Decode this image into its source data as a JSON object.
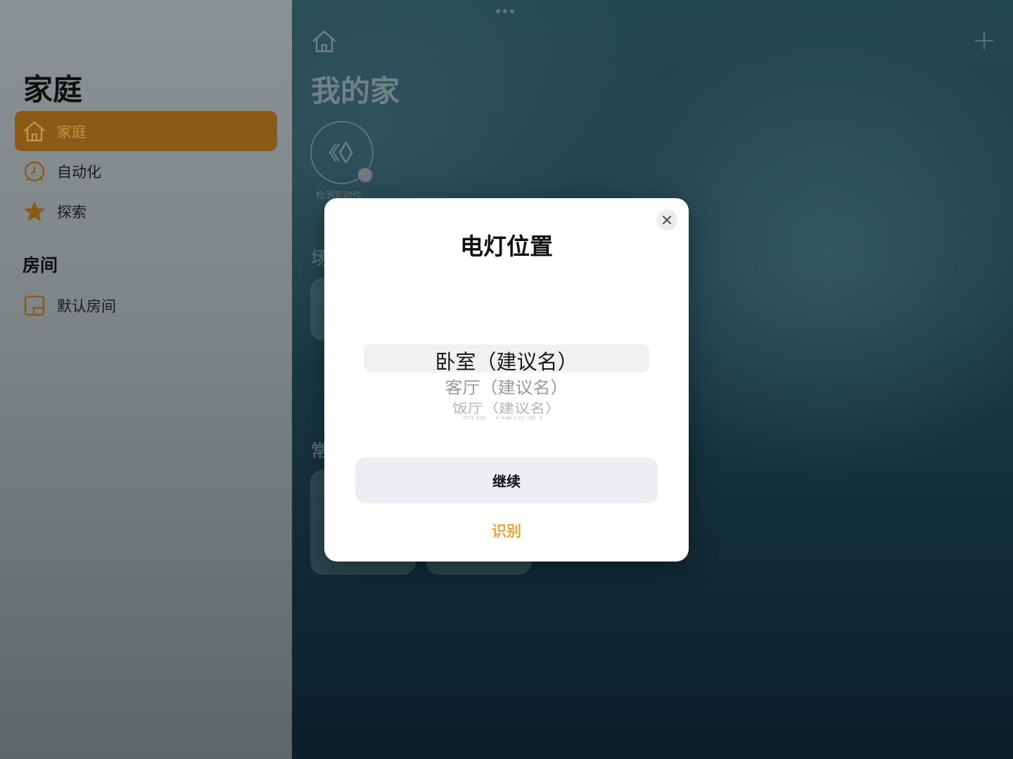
{
  "sidebar": {
    "title": "家庭",
    "items": [
      {
        "label": "家庭",
        "icon": "home-icon",
        "active": true
      },
      {
        "label": "自动化",
        "icon": "clock-icon",
        "active": false
      },
      {
        "label": "探索",
        "icon": "star-icon",
        "active": false
      }
    ],
    "rooms_section": {
      "title": "房间",
      "items": [
        {
          "label": "默认房间",
          "icon": "room-icon"
        }
      ]
    }
  },
  "main": {
    "title": "我的家",
    "status": {
      "label": "检测到动作",
      "icon": "motion-sensor-icon"
    },
    "section_peeks": [
      "场",
      "常"
    ]
  },
  "modal": {
    "title": "电灯位置",
    "picker": {
      "selected": "卧室（建议名）",
      "options": [
        "卧室（建议名）",
        "客厅（建议名）",
        "饭厅（建议名）",
        "厨房（建议名）"
      ]
    },
    "continue_label": "继续",
    "identify_label": "识别"
  },
  "colors": {
    "accent": "#e8a43a",
    "sidebar_active_bg": "#8a5a17"
  }
}
